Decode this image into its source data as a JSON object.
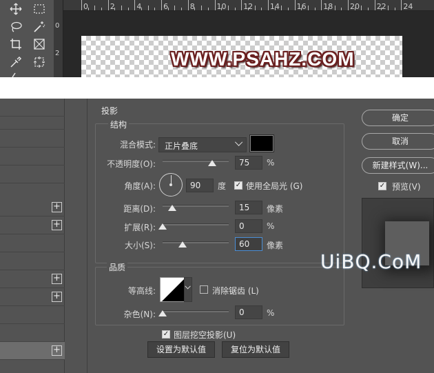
{
  "ps_top": {
    "tools": [
      "move-tool-icon",
      "marquee-tool-icon",
      "lasso-tool-icon",
      "magic-wand-icon",
      "crop-tool-icon",
      "frame-tool-icon",
      "eyedropper-icon",
      "ruler-measure-icon"
    ],
    "ruler_ticks": [
      "0",
      "2",
      "4",
      "6",
      "8",
      "10",
      "12",
      "14",
      "16",
      "18",
      "20",
      "22",
      "24"
    ],
    "ruler_left": [
      "0",
      "2"
    ],
    "canvas_text": "WWW.PSAHZ.COM"
  },
  "dialog": {
    "section_title": "投影",
    "structure_title": "结构",
    "blend_mode_label": "混合模式:",
    "blend_mode_value": "正片叠底",
    "shadow_color": "#000000",
    "opacity_label": "不透明度(O):",
    "opacity_value": "75",
    "opacity_unit": "%",
    "angle_label": "角度(A):",
    "angle_value": "90",
    "angle_unit": "度",
    "global_light_label": "使用全局光 (G)",
    "global_light_checked": true,
    "distance_label": "距离(D):",
    "distance_value": "15",
    "distance_unit": "像素",
    "spread_label": "扩展(R):",
    "spread_value": "0",
    "spread_unit": "%",
    "size_label": "大小(S):",
    "size_value": "60",
    "size_unit": "像素",
    "quality_title": "品质",
    "contour_label": "等高线:",
    "antialias_label": "消除锯齿 (L)",
    "antialias_checked": false,
    "noise_label": "杂色(N):",
    "noise_value": "0",
    "noise_unit": "%",
    "knockout_label": "图层挖空投影(U)",
    "knockout_checked": true,
    "make_default_label": "设置为默认值",
    "reset_default_label": "复位为默认值",
    "ok_label": "确定",
    "cancel_label": "取消",
    "new_style_label": "新建样式(W)...",
    "preview_label": "预览(V)",
    "preview_checked": true,
    "slider_levels": {
      "opacity": 0.75,
      "distance": 0.15,
      "spread": 0.0,
      "size": 0.3,
      "noise": 0.0
    }
  },
  "watermark": "UiBQ.CoM"
}
